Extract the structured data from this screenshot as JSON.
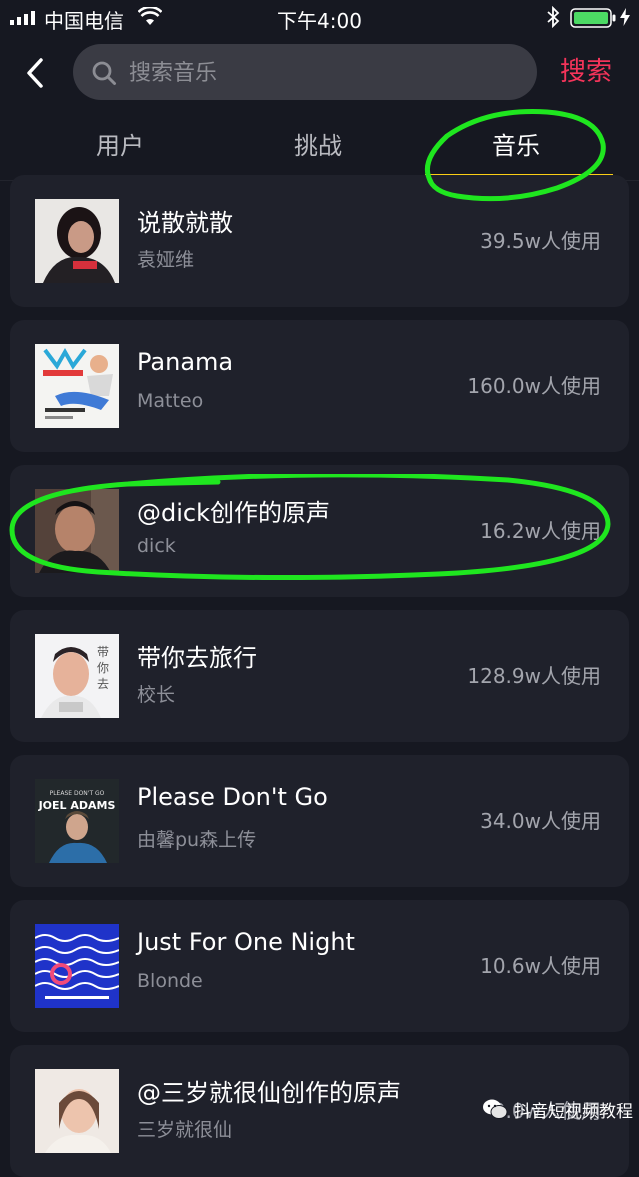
{
  "status_bar": {
    "carrier": "中国电信",
    "time": "下午4:00"
  },
  "header": {
    "back_icon": "chevron-left-icon",
    "search_placeholder": "搜索音乐",
    "search_submit": "搜索",
    "accent_color": "#f4345a"
  },
  "tabs": [
    {
      "label": "用户",
      "active": false
    },
    {
      "label": "挑战",
      "active": false
    },
    {
      "label": "音乐",
      "active": true
    }
  ],
  "tab_indicator_color": "#face15",
  "annotation_color": "#1fe61f",
  "music_list": [
    {
      "title": "说散就散",
      "artist": "袁娅维",
      "usage": "39.5w人使用"
    },
    {
      "title": "Panama",
      "artist": "Matteo",
      "usage": "160.0w人使用"
    },
    {
      "title": "@dick创作的原声",
      "artist": "dick",
      "usage": "16.2w人使用"
    },
    {
      "title": "带你去旅行",
      "artist": "校长",
      "usage": "128.9w人使用"
    },
    {
      "title": "Please Don't Go",
      "artist": "由馨pu森上传",
      "usage": "34.0w人使用"
    },
    {
      "title": "Just For One Night",
      "artist": "Blonde",
      "usage": "10.6w人使用"
    },
    {
      "title": "@三岁就很仙创作的原声",
      "artist": "三岁就很仙",
      "usage": "9.0w人使用"
    }
  ],
  "watermark": {
    "text": "抖音短视频教程",
    "icon": "wechat-icon"
  }
}
